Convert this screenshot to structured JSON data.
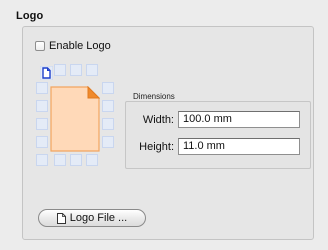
{
  "section": {
    "title": "Logo"
  },
  "enable_logo": {
    "label": "Enable Logo",
    "checked": false
  },
  "position_grid": {
    "selected": "top-left"
  },
  "dimensions": {
    "title": "Dimensions",
    "width_label": "Width:",
    "width_value": "100.0 mm",
    "height_label": "Height:",
    "height_value": "11.0 mm"
  },
  "logo_file_button": {
    "label": "Logo File ..."
  },
  "colors": {
    "page_fill": "#ffd9b8",
    "page_stroke": "#f2a55f",
    "page_corner": "#f08a2c",
    "anchor_fill": "#e4ebf7",
    "anchor_stroke": "#c9d6ef",
    "active_doc": "#1c3fcc"
  }
}
